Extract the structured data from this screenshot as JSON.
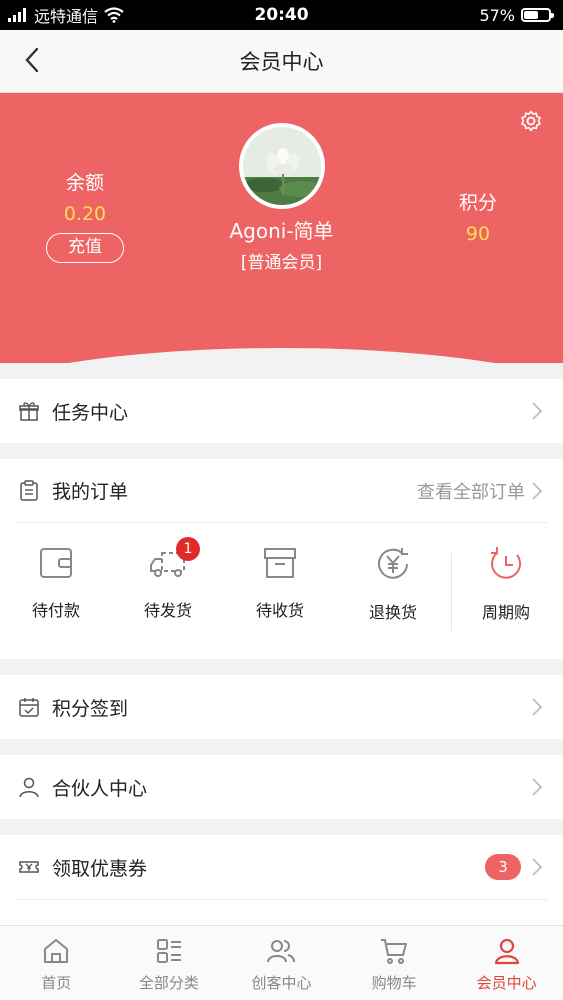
{
  "status_bar": {
    "carrier": "远特通信",
    "time": "20:40",
    "battery": "57%",
    "battery_level": 0.57
  },
  "nav": {
    "title": "会员中心"
  },
  "profile": {
    "balance_label": "余额",
    "balance_value": "0.20",
    "recharge_label": "充值",
    "username": "Agoni-简单",
    "member_level": "[普通会员]",
    "points_label": "积分",
    "points_value": "90"
  },
  "menu": {
    "task_center": "任务中心",
    "orders_title": "我的订单",
    "orders_view_all": "查看全部订单",
    "checkin": "积分签到",
    "partner_center": "合伙人中心",
    "coupons": "领取优惠券",
    "coupons_count": "3"
  },
  "orders": {
    "items": [
      {
        "label": "待付款",
        "icon": "wallet-icon"
      },
      {
        "label": "待发货",
        "icon": "truck-icon",
        "badge": "1"
      },
      {
        "label": "待收货",
        "icon": "box-icon"
      },
      {
        "label": "退换货",
        "icon": "yen-refund-icon"
      },
      {
        "label": "周期购",
        "icon": "clock-icon"
      }
    ]
  },
  "tabbar": {
    "items": [
      {
        "label": "首页",
        "icon": "home-icon"
      },
      {
        "label": "全部分类",
        "icon": "category-icon"
      },
      {
        "label": "创客中心",
        "icon": "users-icon"
      },
      {
        "label": "购物车",
        "icon": "cart-icon"
      },
      {
        "label": "会员中心",
        "icon": "user-icon",
        "active": true
      }
    ]
  },
  "colors": {
    "brand": "#ee6363",
    "accent_yellow": "#ffdd55",
    "active_tab": "#e0463c",
    "badge_red": "#e12a2a"
  }
}
